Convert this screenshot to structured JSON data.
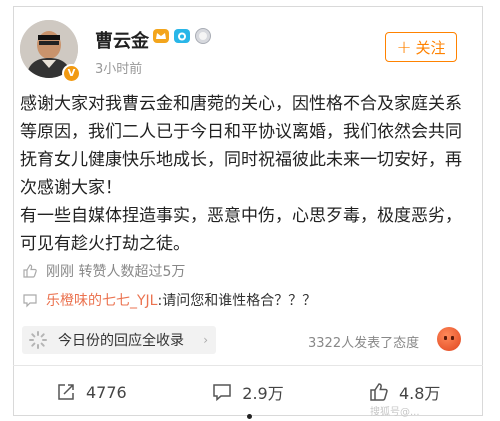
{
  "post": {
    "author": "曹云金",
    "time": "3小时前",
    "follow_label": "关注",
    "content_paragraphs": [
      "感谢大家对我曹云金和唐菀的关心，因性格不合及家庭关系等原因，我们二人已于今日和平协议离婚，我们依然会共同抚育女儿健康快乐地成长，同时祝福彼此未来一切安好，再次感谢大家！",
      "有一些自媒体捏造事实，恶意中伤，心思歹毒，极度恶劣，可见有趁火打劫之徒。"
    ]
  },
  "repost": {
    "text": "刚刚 转赞人数超过5万"
  },
  "top_comment": {
    "user": "乐橙味的七七_YJL",
    "text": ":请问您和谁性格合？？？"
  },
  "hot_comments": {
    "label": "今日份的回应全收录"
  },
  "reactions": {
    "text": "3322人发表了态度"
  },
  "actions": {
    "share": "4776",
    "comment": "2.9万",
    "like": "4.8万"
  },
  "watermark": "搜狐号@..."
}
